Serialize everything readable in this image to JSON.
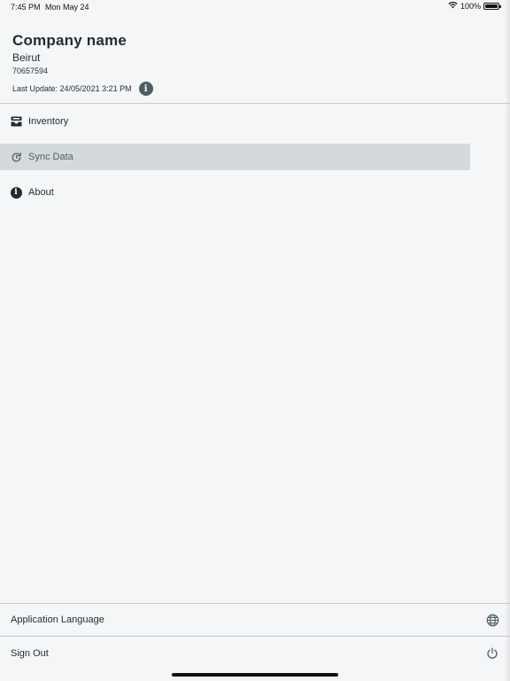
{
  "status_bar": {
    "time": "7:45 PM",
    "date": "Mon May 24",
    "battery_percent": "100%",
    "battery_level": 1.0
  },
  "header": {
    "company_name": "Company name",
    "city": "Beirut",
    "phone": "70657594",
    "last_update": "Last Update: 24/05/2021 3:21 PM",
    "info_icon": "info-icon"
  },
  "menu": {
    "items": [
      {
        "label": "Inventory",
        "icon": "inventory-icon",
        "active": false
      },
      {
        "label": "Sync Data",
        "icon": "sync-icon",
        "active": true
      },
      {
        "label": "About",
        "icon": "info-icon",
        "active": false
      }
    ]
  },
  "footer": {
    "language_label": "Application Language",
    "language_icon": "globe-icon",
    "signout_label": "Sign Out",
    "signout_icon": "power-icon"
  },
  "colors": {
    "background": "#f5f6f8",
    "active_item": "#d4dadb",
    "text": "#1f2d2d",
    "accent": "#4d5f66",
    "divider": "#c6cacc"
  }
}
